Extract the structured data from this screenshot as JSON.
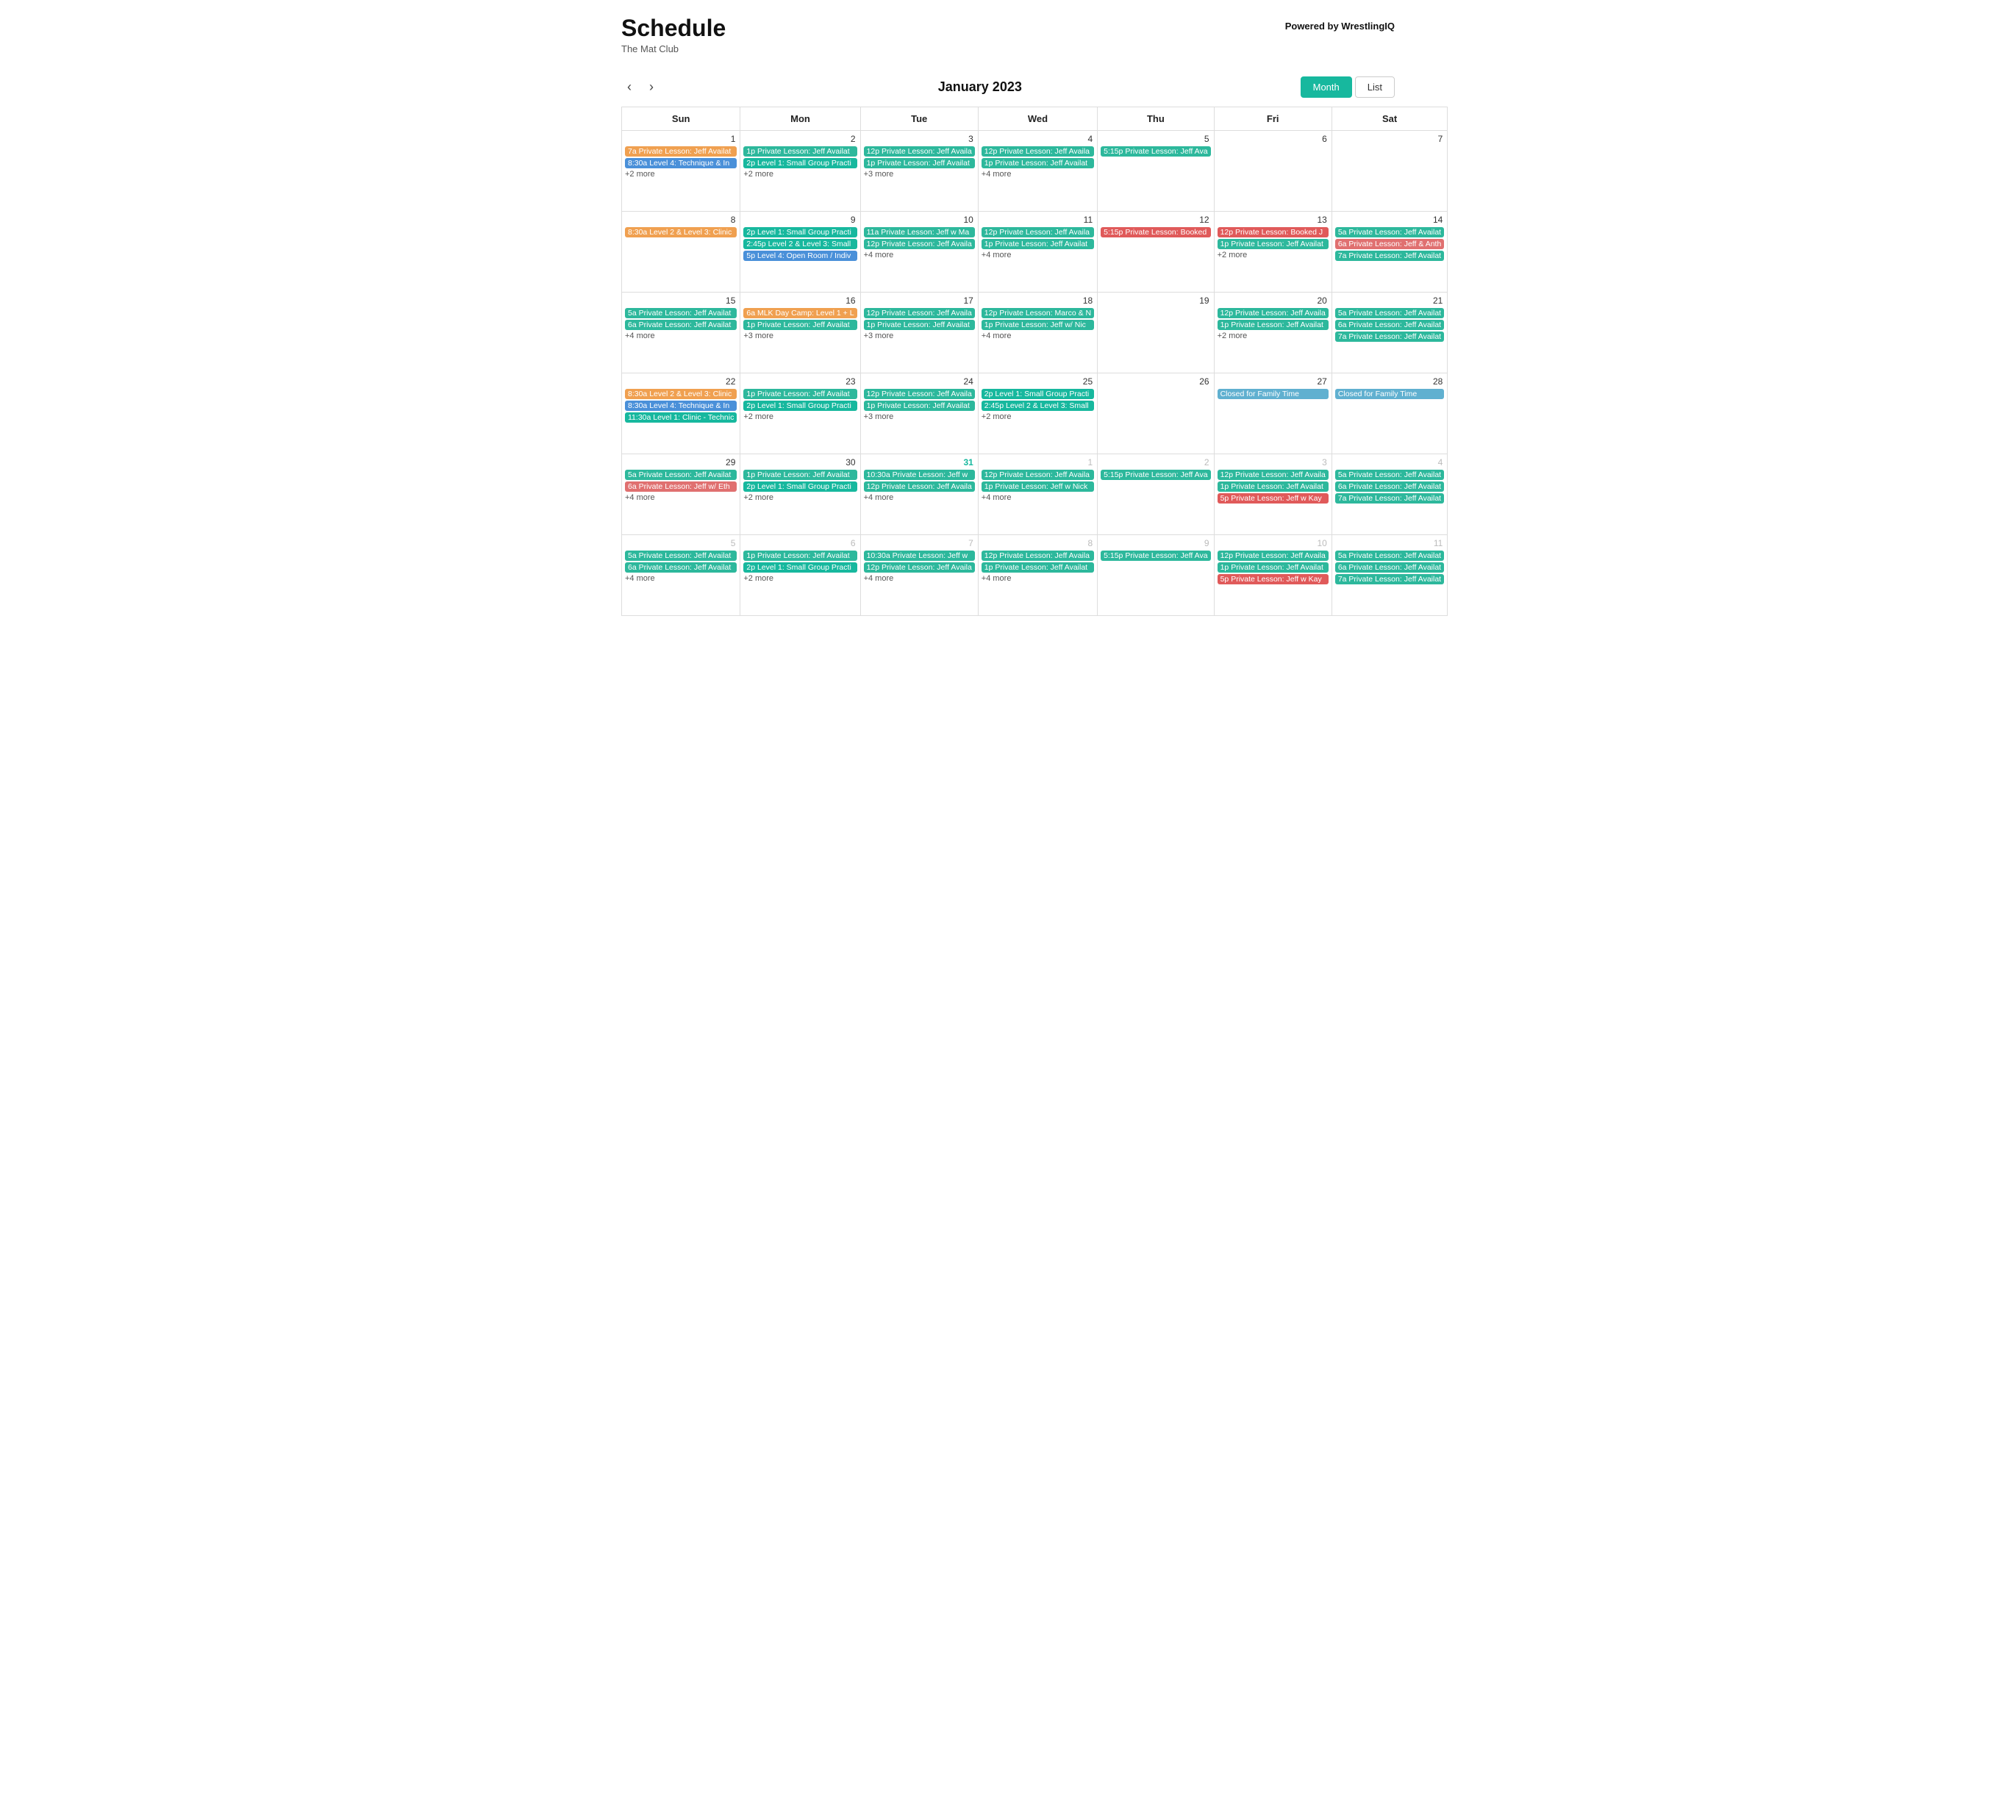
{
  "header": {
    "title": "Schedule",
    "subtitle": "The Mat Club",
    "powered_by_prefix": "Powered by ",
    "powered_by_name": "WrestlingIQ"
  },
  "controls": {
    "prev_label": "‹",
    "next_label": "›",
    "month_title": "January 2023",
    "view_month": "Month",
    "view_list": "List"
  },
  "days": [
    "Sun",
    "Mon",
    "Tue",
    "Wed",
    "Thu",
    "Fri",
    "Sat"
  ],
  "rows": [
    {
      "cells": [
        {
          "num": "1",
          "type": "current",
          "events": [
            {
              "label": "7a Private Lesson: Jeff Availat",
              "color": "ev-orange"
            },
            {
              "label": "8:30a Level 4: Technique & In",
              "color": "ev-blue"
            }
          ],
          "more": "+2 more"
        },
        {
          "num": "2",
          "type": "current",
          "events": [
            {
              "label": "1p Private Lesson: Jeff Availat",
              "color": "ev-green"
            },
            {
              "label": "2p Level 1: Small Group Practi",
              "color": "ev-teal"
            }
          ],
          "more": "+2 more"
        },
        {
          "num": "3",
          "type": "current",
          "events": [
            {
              "label": "12p Private Lesson: Jeff Availa",
              "color": "ev-green"
            },
            {
              "label": "1p Private Lesson: Jeff Availat",
              "color": "ev-green"
            }
          ],
          "more": "+3 more"
        },
        {
          "num": "4",
          "type": "current",
          "events": [
            {
              "label": "12p Private Lesson: Jeff Availa",
              "color": "ev-green"
            },
            {
              "label": "1p Private Lesson: Jeff Availat",
              "color": "ev-green"
            }
          ],
          "more": "+4 more"
        },
        {
          "num": "5",
          "type": "current",
          "events": [
            {
              "label": "5:15p Private Lesson: Jeff Ava",
              "color": "ev-green"
            }
          ],
          "more": ""
        },
        {
          "num": "6",
          "type": "current",
          "events": [],
          "more": ""
        },
        {
          "num": "7",
          "type": "current",
          "events": [],
          "more": ""
        }
      ]
    },
    {
      "cells": [
        {
          "num": "8",
          "type": "current",
          "events": [
            {
              "label": "8:30a Level 2 & Level 3: Clinic",
              "color": "ev-orange"
            }
          ],
          "more": ""
        },
        {
          "num": "9",
          "type": "current",
          "events": [
            {
              "label": "2p Level 1: Small Group Practi",
              "color": "ev-teal"
            },
            {
              "label": "2:45p Level 2 & Level 3: Small",
              "color": "ev-teal"
            },
            {
              "label": "5p Level 4: Open Room / Indiv",
              "color": "ev-blue"
            }
          ],
          "more": ""
        },
        {
          "num": "10",
          "type": "current",
          "events": [
            {
              "label": "11a Private Lesson: Jeff w Ma",
              "color": "ev-green"
            },
            {
              "label": "12p Private Lesson: Jeff Availa",
              "color": "ev-green"
            }
          ],
          "more": "+4 more"
        },
        {
          "num": "11",
          "type": "current",
          "events": [
            {
              "label": "12p Private Lesson: Jeff Availa",
              "color": "ev-green"
            },
            {
              "label": "1p Private Lesson: Jeff Availat",
              "color": "ev-green"
            }
          ],
          "more": "+4 more"
        },
        {
          "num": "12",
          "type": "current",
          "events": [
            {
              "label": "5:15p Private Lesson: Booked",
              "color": "ev-red"
            }
          ],
          "more": ""
        },
        {
          "num": "13",
          "type": "current",
          "events": [
            {
              "label": "12p Private Lesson: Booked J",
              "color": "ev-red"
            },
            {
              "label": "1p Private Lesson: Jeff Availat",
              "color": "ev-green"
            }
          ],
          "more": "+2 more"
        },
        {
          "num": "14",
          "type": "current",
          "events": [
            {
              "label": "5a Private Lesson: Jeff Availat",
              "color": "ev-green"
            },
            {
              "label": "6a Private Lesson: Jeff & Anth",
              "color": "ev-salmon"
            },
            {
              "label": "7a Private Lesson: Jeff Availat",
              "color": "ev-green"
            }
          ],
          "more": ""
        }
      ]
    },
    {
      "cells": [
        {
          "num": "15",
          "type": "current",
          "events": [
            {
              "label": "5a Private Lesson: Jeff Availat",
              "color": "ev-green"
            },
            {
              "label": "6a Private Lesson: Jeff Availat",
              "color": "ev-green"
            }
          ],
          "more": "+4 more"
        },
        {
          "num": "16",
          "type": "current",
          "events": [
            {
              "label": "6a MLK Day Camp: Level 1 + L",
              "color": "ev-orange"
            },
            {
              "label": "1p Private Lesson: Jeff Availat",
              "color": "ev-green"
            }
          ],
          "more": "+3 more"
        },
        {
          "num": "17",
          "type": "current",
          "events": [
            {
              "label": "12p Private Lesson: Jeff Availa",
              "color": "ev-green"
            },
            {
              "label": "1p Private Lesson: Jeff Availat",
              "color": "ev-green"
            }
          ],
          "more": "+3 more"
        },
        {
          "num": "18",
          "type": "current",
          "events": [
            {
              "label": "12p Private Lesson: Marco & N",
              "color": "ev-green"
            },
            {
              "label": "1p Private Lesson: Jeff w/ Nic",
              "color": "ev-green"
            }
          ],
          "more": "+4 more"
        },
        {
          "num": "19",
          "type": "current",
          "events": [],
          "more": ""
        },
        {
          "num": "20",
          "type": "current",
          "events": [
            {
              "label": "12p Private Lesson: Jeff Availa",
              "color": "ev-green"
            },
            {
              "label": "1p Private Lesson: Jeff Availat",
              "color": "ev-green"
            }
          ],
          "more": "+2 more"
        },
        {
          "num": "21",
          "type": "current",
          "events": [
            {
              "label": "5a Private Lesson: Jeff Availat",
              "color": "ev-green"
            },
            {
              "label": "6a Private Lesson: Jeff Availat",
              "color": "ev-green"
            },
            {
              "label": "7a Private Lesson: Jeff Availat",
              "color": "ev-green"
            }
          ],
          "more": ""
        }
      ]
    },
    {
      "cells": [
        {
          "num": "22",
          "type": "current",
          "events": [
            {
              "label": "8:30a Level 2 & Level 3: Clinic",
              "color": "ev-orange"
            },
            {
              "label": "8:30a Level 4: Technique & In",
              "color": "ev-blue"
            },
            {
              "label": "11:30a Level 1: Clinic - Technic",
              "color": "ev-teal"
            }
          ],
          "more": ""
        },
        {
          "num": "23",
          "type": "current",
          "events": [
            {
              "label": "1p Private Lesson: Jeff Availat",
              "color": "ev-green"
            },
            {
              "label": "2p Level 1: Small Group Practi",
              "color": "ev-teal"
            }
          ],
          "more": "+2 more"
        },
        {
          "num": "24",
          "type": "current",
          "events": [
            {
              "label": "12p Private Lesson: Jeff Availa",
              "color": "ev-green"
            },
            {
              "label": "1p Private Lesson: Jeff Availat",
              "color": "ev-green"
            }
          ],
          "more": "+3 more"
        },
        {
          "num": "25",
          "type": "current",
          "events": [
            {
              "label": "2p Level 1: Small Group Practi",
              "color": "ev-teal"
            },
            {
              "label": "2:45p Level 2 & Level 3: Small",
              "color": "ev-teal"
            }
          ],
          "more": "+2 more"
        },
        {
          "num": "26",
          "type": "current",
          "events": [],
          "more": ""
        },
        {
          "num": "27",
          "type": "current",
          "events": [
            {
              "label": "Closed for Family Time",
              "color": "ev-closed"
            }
          ],
          "more": ""
        },
        {
          "num": "28",
          "type": "current",
          "events": [
            {
              "label": "Closed for Family Time",
              "color": "ev-closed"
            }
          ],
          "more": ""
        }
      ]
    },
    {
      "cells": [
        {
          "num": "29",
          "type": "current",
          "events": [
            {
              "label": "5a Private Lesson: Jeff Availat",
              "color": "ev-green"
            },
            {
              "label": "6a Private Lesson: Jeff w/ Eth",
              "color": "ev-salmon"
            }
          ],
          "more": "+4 more"
        },
        {
          "num": "30",
          "type": "current",
          "events": [
            {
              "label": "1p Private Lesson: Jeff Availat",
              "color": "ev-green"
            },
            {
              "label": "2p Level 1: Small Group Practi",
              "color": "ev-teal"
            }
          ],
          "more": "+2 more"
        },
        {
          "num": "31",
          "type": "today",
          "events": [
            {
              "label": "10:30a Private Lesson: Jeff w",
              "color": "ev-green"
            },
            {
              "label": "12p Private Lesson: Jeff Availa",
              "color": "ev-green"
            }
          ],
          "more": "+4 more"
        },
        {
          "num": "1",
          "type": "other",
          "events": [
            {
              "label": "12p Private Lesson: Jeff Availa",
              "color": "ev-green"
            },
            {
              "label": "1p Private Lesson: Jeff w Nick",
              "color": "ev-green"
            }
          ],
          "more": "+4 more"
        },
        {
          "num": "2",
          "type": "other",
          "events": [
            {
              "label": "5:15p Private Lesson: Jeff Ava",
              "color": "ev-green"
            }
          ],
          "more": ""
        },
        {
          "num": "3",
          "type": "other",
          "events": [
            {
              "label": "12p Private Lesson: Jeff Availa",
              "color": "ev-green"
            },
            {
              "label": "1p Private Lesson: Jeff Availat",
              "color": "ev-green"
            },
            {
              "label": "5p Private Lesson: Jeff w Kay",
              "color": "ev-red"
            }
          ],
          "more": ""
        },
        {
          "num": "4",
          "type": "other",
          "events": [
            {
              "label": "5a Private Lesson: Jeff Availat",
              "color": "ev-green"
            },
            {
              "label": "6a Private Lesson: Jeff Availat",
              "color": "ev-green"
            },
            {
              "label": "7a Private Lesson: Jeff Availat",
              "color": "ev-green"
            }
          ],
          "more": ""
        }
      ]
    },
    {
      "cells": [
        {
          "num": "5",
          "type": "other",
          "events": [
            {
              "label": "5a Private Lesson: Jeff Availat",
              "color": "ev-green"
            },
            {
              "label": "6a Private Lesson: Jeff Availat",
              "color": "ev-green"
            }
          ],
          "more": "+4 more"
        },
        {
          "num": "6",
          "type": "other",
          "events": [
            {
              "label": "1p Private Lesson: Jeff Availat",
              "color": "ev-green"
            },
            {
              "label": "2p Level 1: Small Group Practi",
              "color": "ev-teal"
            }
          ],
          "more": "+2 more"
        },
        {
          "num": "7",
          "type": "other",
          "events": [
            {
              "label": "10:30a Private Lesson: Jeff w",
              "color": "ev-green"
            },
            {
              "label": "12p Private Lesson: Jeff Availa",
              "color": "ev-green"
            }
          ],
          "more": "+4 more"
        },
        {
          "num": "8",
          "type": "other",
          "events": [
            {
              "label": "12p Private Lesson: Jeff Availa",
              "color": "ev-green"
            },
            {
              "label": "1p Private Lesson: Jeff Availat",
              "color": "ev-green"
            }
          ],
          "more": "+4 more"
        },
        {
          "num": "9",
          "type": "other",
          "events": [
            {
              "label": "5:15p Private Lesson: Jeff Ava",
              "color": "ev-green"
            }
          ],
          "more": ""
        },
        {
          "num": "10",
          "type": "other",
          "events": [
            {
              "label": "12p Private Lesson: Jeff Availa",
              "color": "ev-green"
            },
            {
              "label": "1p Private Lesson: Jeff Availat",
              "color": "ev-green"
            },
            {
              "label": "5p Private Lesson: Jeff w Kay",
              "color": "ev-red"
            }
          ],
          "more": ""
        },
        {
          "num": "11",
          "type": "other",
          "events": [
            {
              "label": "5a Private Lesson: Jeff Availat",
              "color": "ev-green"
            },
            {
              "label": "6a Private Lesson: Jeff Availat",
              "color": "ev-green"
            },
            {
              "label": "7a Private Lesson: Jeff Availat",
              "color": "ev-green"
            }
          ],
          "more": ""
        }
      ]
    }
  ]
}
